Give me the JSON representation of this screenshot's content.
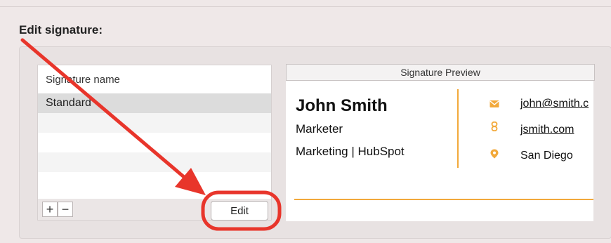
{
  "page_title": "Edit signature:",
  "signature_list": {
    "header": "Signature name",
    "items": [
      {
        "label": "Standard"
      }
    ],
    "add_label": "+",
    "remove_label": "−"
  },
  "edit_button": {
    "label": "Edit"
  },
  "preview": {
    "header": "Signature Preview",
    "name": "John Smith",
    "title": "Marketer",
    "department_company": "Marketing | HubSpot",
    "email": "john@smith.c",
    "website": "jsmith.com",
    "location": "San Diego"
  },
  "colors": {
    "accent": "#f2a93b",
    "annotation": "#e8352b",
    "selected_row": "#dcdcdc",
    "stripe_row": "#f4f4f4"
  }
}
